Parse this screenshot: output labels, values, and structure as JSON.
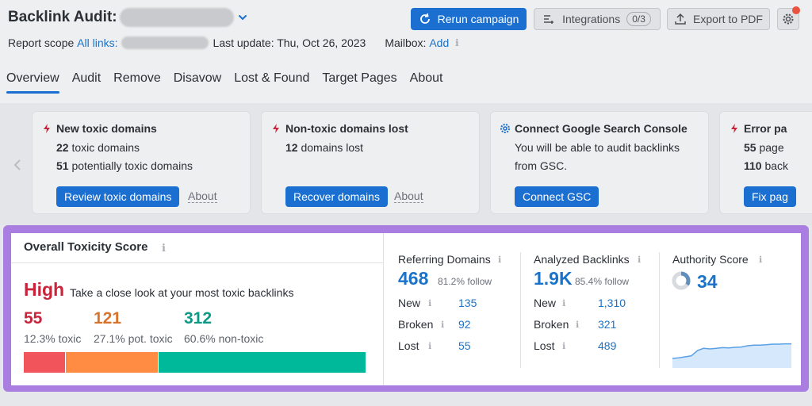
{
  "header": {
    "title": "Backlink Audit:",
    "scope_label": "Report scope",
    "scope_link": "All links:",
    "last_update": "Last update: Thu, Oct 26, 2023",
    "mailbox_label": "Mailbox:",
    "mailbox_link": "Add",
    "rerun_label": "Rerun campaign",
    "integrations_label": "Integrations",
    "integrations_badge": "0/3",
    "export_label": "Export to PDF"
  },
  "tabs": [
    {
      "label": "Overview",
      "active": true
    },
    {
      "label": "Audit"
    },
    {
      "label": "Remove"
    },
    {
      "label": "Disavow"
    },
    {
      "label": "Lost & Found"
    },
    {
      "label": "Target Pages"
    },
    {
      "label": "About"
    }
  ],
  "cards": [
    {
      "title": "New toxic domains",
      "icon": "lightning-icon",
      "lines": [
        {
          "num": "22",
          "text": " toxic domains"
        },
        {
          "num": "51",
          "text": " potentially toxic domains"
        }
      ],
      "button": "Review toxic domains",
      "about": "About"
    },
    {
      "title": "Non-toxic domains lost",
      "icon": "lightning-icon",
      "lines": [
        {
          "num": "12",
          "text": " domains lost"
        }
      ],
      "button": "Recover domains",
      "about": "About"
    },
    {
      "title": "Connect Google Search Console",
      "icon": "gear-icon",
      "lines": [
        {
          "text": "You will be able to audit backlinks"
        },
        {
          "text": "from GSC."
        }
      ],
      "button": "Connect GSC"
    },
    {
      "title": "Error pa",
      "icon": "lightning-icon",
      "lines": [
        {
          "num": "55",
          "text": " page"
        },
        {
          "num": "110",
          "text": " back"
        }
      ],
      "button": "Fix pag"
    }
  ],
  "toxicity": {
    "title": "Overall Toxicity Score",
    "level": "High",
    "level_text": "Take a close look at your most toxic backlinks",
    "toxic": {
      "value": "55",
      "label": "12.3% toxic",
      "fraction": 0.123,
      "color": "#f2545b"
    },
    "potential": {
      "value": "121",
      "label": "27.1% pot. toxic",
      "fraction": 0.271,
      "color": "#ff8c42"
    },
    "non_toxic": {
      "value": "312",
      "label": "60.6% non-toxic",
      "fraction": 0.606,
      "color": "#00b99a"
    }
  },
  "referring_domains": {
    "title": "Referring Domains",
    "value": "468",
    "follow": "81.2% follow",
    "rows": [
      {
        "label": "New",
        "value": "135"
      },
      {
        "label": "Broken",
        "value": "92"
      },
      {
        "label": "Lost",
        "value": "55"
      }
    ]
  },
  "analyzed_backlinks": {
    "title": "Analyzed Backlinks",
    "value": "1.9K",
    "follow": "85.4% follow",
    "rows": [
      {
        "label": "New",
        "value": "1,310"
      },
      {
        "label": "Broken",
        "value": "321"
      },
      {
        "label": "Lost",
        "value": "489"
      }
    ]
  },
  "authority": {
    "title": "Authority Score",
    "value": "34",
    "ring_fraction": 0.34,
    "trend": [
      0.3,
      0.32,
      0.35,
      0.38,
      0.55,
      0.62,
      0.6,
      0.62,
      0.64,
      0.63,
      0.65,
      0.66,
      0.7,
      0.72,
      0.72,
      0.73,
      0.75,
      0.75,
      0.76,
      0.76
    ]
  },
  "colors": {
    "accent": "#1a6fd0",
    "frame": "#a97ee0",
    "high": "#c8243c"
  }
}
